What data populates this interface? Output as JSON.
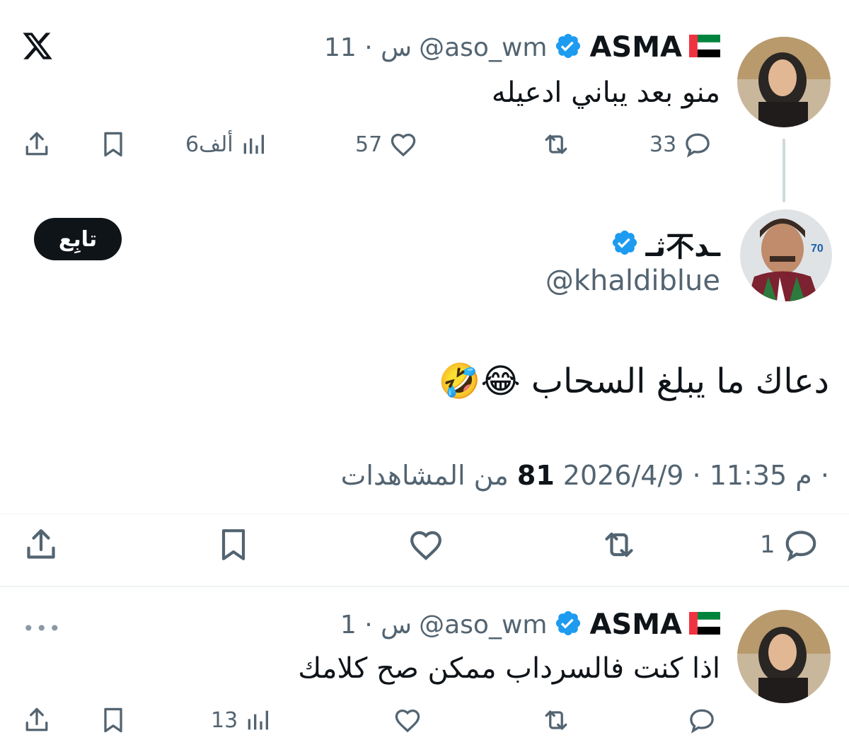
{
  "app": {
    "logo": "x-logo"
  },
  "parent_tweet": {
    "name": "ASMA",
    "flag": "uae-flag-icon",
    "handle": "@aso_wm",
    "time": "11 · س",
    "text": "منو بعد يباني ادعيله",
    "replies": "33",
    "likes": "57",
    "views": "6ألف"
  },
  "main_tweet": {
    "name": "ثـ不ـد",
    "handle": "@khaldiblue",
    "follow_label": "تابِع",
    "text": "دعاك ما يبلغ السحاب 😂🤣",
    "date_time": "2026/4/9 · 11:35 م ·",
    "views_count": "81",
    "views_label": "من المشاهدات",
    "replies": "1"
  },
  "reply_tweet": {
    "name": "ASMA",
    "flag": "uae-flag-icon",
    "handle": "@aso_wm",
    "time": "1 · س",
    "text": "اذا كنت فالسرداب ممكن صح كلامك",
    "views": "13"
  },
  "colors": {
    "verified": "#1d9bf0",
    "text": "#0f1419",
    "secondary": "#536471",
    "follow_bg": "#0f1419",
    "divider": "#eff3f4"
  }
}
